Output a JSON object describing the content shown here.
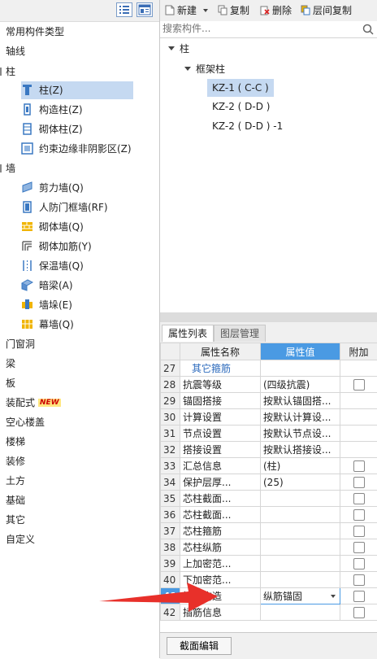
{
  "left_panel": {
    "categories": [
      {
        "label": "常用构件类型"
      },
      {
        "label": "轴线"
      },
      {
        "label": "柱"
      },
      {
        "label": "墙"
      },
      {
        "label": "门窗洞"
      },
      {
        "label": "梁"
      },
      {
        "label": "板"
      },
      {
        "label": "装配式",
        "badge": "NEW"
      },
      {
        "label": "空心楼盖"
      },
      {
        "label": "楼梯"
      },
      {
        "label": "装修"
      },
      {
        "label": "土方"
      },
      {
        "label": "基础"
      },
      {
        "label": "其它"
      },
      {
        "label": "自定义"
      }
    ],
    "column_items": [
      {
        "label": "柱(Z)"
      },
      {
        "label": "构造柱(Z)"
      },
      {
        "label": "砌体柱(Z)"
      },
      {
        "label": "约束边缘非阴影区(Z)"
      }
    ],
    "wall_items": [
      {
        "label": "剪力墙(Q)"
      },
      {
        "label": "人防门框墙(RF)"
      },
      {
        "label": "砌体墙(Q)"
      },
      {
        "label": "砌体加筋(Y)"
      },
      {
        "label": "保温墙(Q)"
      },
      {
        "label": "暗梁(A)"
      },
      {
        "label": "墙垛(E)"
      },
      {
        "label": "幕墙(Q)"
      }
    ]
  },
  "toolbar": {
    "new_label": "新建",
    "copy_label": "复制",
    "delete_label": "删除",
    "floor_copy_label": "层间复制"
  },
  "search": {
    "placeholder": "搜索构件..."
  },
  "tree": {
    "root": "柱",
    "group": "框架柱",
    "items": [
      "KZ-1 ( C-C )",
      "KZ-2 ( D-D )",
      "KZ-2 ( D-D ) -1"
    ]
  },
  "properties": {
    "tabs": [
      "属性列表",
      "图层管理"
    ],
    "headers": {
      "name": "属性名称",
      "value": "属性值",
      "extra": "附加"
    },
    "rows": [
      {
        "num": "27",
        "name": "其它箍筋",
        "value": "",
        "check": false,
        "blue": true
      },
      {
        "num": "28",
        "name": "抗震等级",
        "value": "(四级抗震)",
        "check": true
      },
      {
        "num": "29",
        "name": "锚固搭接",
        "value": "按默认锚固搭...",
        "check": false
      },
      {
        "num": "30",
        "name": "计算设置",
        "value": "按默认计算设...",
        "check": false
      },
      {
        "num": "31",
        "name": "节点设置",
        "value": "按默认节点设...",
        "check": false
      },
      {
        "num": "32",
        "name": "搭接设置",
        "value": "按默认搭接设...",
        "check": false
      },
      {
        "num": "33",
        "name": "汇总信息",
        "value": "(柱)",
        "check": true
      },
      {
        "num": "34",
        "name": "保护层厚...",
        "value": "(25)",
        "check": true
      },
      {
        "num": "35",
        "name": "芯柱截面...",
        "value": "",
        "check": true
      },
      {
        "num": "36",
        "name": "芯柱截面...",
        "value": "",
        "check": true
      },
      {
        "num": "37",
        "name": "芯柱箍筋",
        "value": "",
        "check": true
      },
      {
        "num": "38",
        "name": "芯柱纵筋",
        "value": "",
        "check": true
      },
      {
        "num": "39",
        "name": "上加密范...",
        "value": "",
        "check": true
      },
      {
        "num": "40",
        "name": "下加密范...",
        "value": "",
        "check": true
      },
      {
        "num": "41",
        "name": "插筋构造",
        "value": "纵筋锚固",
        "check": true,
        "active": true
      },
      {
        "num": "42",
        "name": "插筋信息",
        "value": "",
        "check": true
      }
    ]
  },
  "bottom": {
    "edit_label": "截面编辑"
  },
  "colors": {
    "selection": "#c5d9f1",
    "header_highlight": "#4a9ae3",
    "arrow": "#e8302a"
  }
}
